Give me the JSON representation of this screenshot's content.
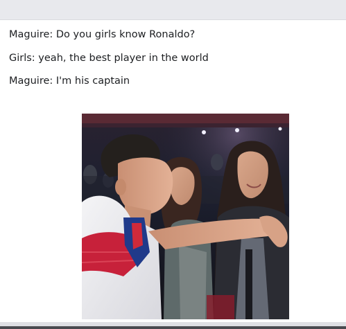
{
  "post": {
    "caption_lines": [
      "Maguire: Do you girls know Ronaldo?",
      "Girls: yeah, the best player in the world",
      "Maguire: I'm his captain"
    ],
    "photo": {
      "description_icon": "meme-photo-stadium-three-people"
    }
  }
}
